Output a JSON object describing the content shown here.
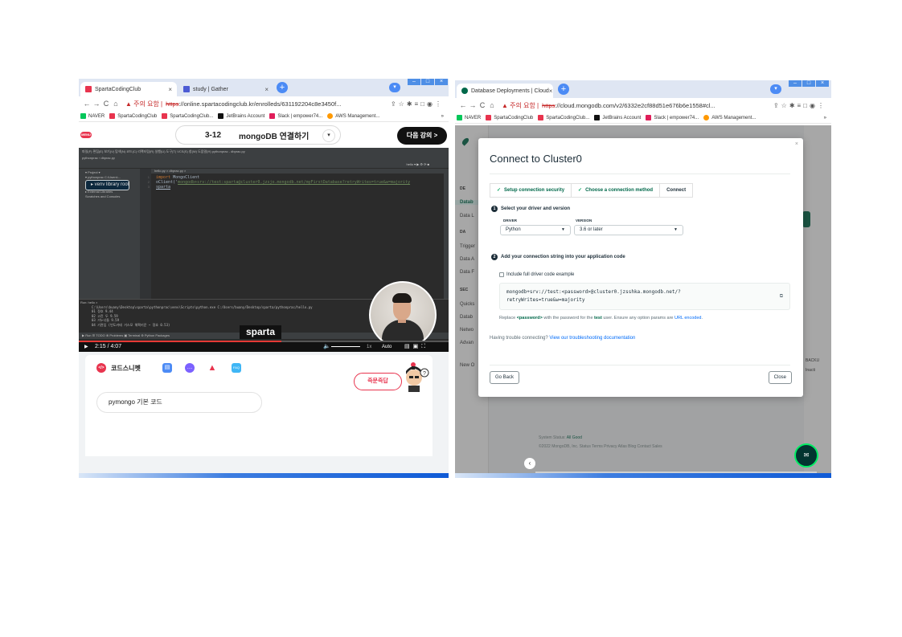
{
  "left": {
    "tabs": [
      {
        "label": "SpartaCodingClub",
        "favcolor": "#e8344e"
      },
      {
        "label": "study | Gather",
        "favcolor": "#4c5bd4"
      }
    ],
    "address": {
      "warning": "▲ 주의 요함 |",
      "https": "https",
      "url_rest": "://online.spartacodingclub.kr/enrolleds/631192204c8e3450f..."
    },
    "bookmarks": [
      "NAVER",
      "SpartaCodingClub",
      "SpartaCodingClub...",
      "JetBrains Account",
      "Slack | empower74...",
      "AWS Management..."
    ],
    "bookmarks_more": "»",
    "lecture": {
      "number": "3-12",
      "title": "mongoDB 연결하기",
      "next_label": "다음 강의 >"
    },
    "ide": {
      "menu": "파일(F)  편집(E)  보기(V)  탐색(N)  코드(C)  리팩터링(R)  실행(U)  도구(T)  VCS(S)  창(W)  도움말(H)   pythonprac - dbprac.py",
      "crumb": "pythonprac  ›  dbprac.py",
      "run_config": "hello ▾  ▶  ⚙  ⟳  ■",
      "tree": [
        "▾ Project ▾",
        "▾ pythonprac  C:\\Users\\...",
        "  ▸ venv  library root",
        "    dbprac.py",
        "    hello.py",
        "▸ External Libraries",
        "  Scratches and Consoles"
      ],
      "editor_tab": "hello.py  ×   dbprac.py  ×",
      "code_lines": [
        {
          "kw": "import ",
          "rest": "MongoClient"
        },
        {
          "kw": "",
          "rest": "oClient('",
          "str": "mongodb+srv://test:sparta@cluster0.jzsjo.mongodb.net/myFirstDatabase?retryWrites=true&w=majority"
        },
        {
          "kw": "",
          "rest": "sparta"
        }
      ],
      "console_header": "Run:  hello ×",
      "console_lines": [
        "C:\\Users\\buany\\Desktop\\sparta\\pythonprac\\venv\\Scripts\\python.exe C:/Users/buany/Desktop/sparta/pythonprac/hello.py",
        "01 정호 9.44",
        "02 고진 두 9.59",
        "03 거누너들 9.59",
        "04 기관입 (빈도카테 거스모 해확키운 ~ 정호 0.53)"
      ],
      "status": "▶ Run   ☰ TODO   ⊗ Problems   ▣ Terminal   ⊕ Python Packages"
    },
    "caption": "sparta",
    "video": {
      "time": "2:15 / 4:07",
      "progress": 0.547,
      "speed": "1x",
      "quality": "Auto"
    },
    "panel": {
      "snippet_tab": "코드스니펫",
      "ask_label": "즉문즉답",
      "snippet_item": "pymongo 기본 코드"
    }
  },
  "right": {
    "tabs": [
      {
        "label": "Database Deployments | Cloud",
        "favcolor": "#00684a"
      }
    ],
    "address": {
      "warning": "▲ 주의 요함 |",
      "https": "https",
      "url_rest": "://cloud.mongodb.com/v2/6332e2cf88d51e676b6e1558#cl..."
    },
    "bookmarks": [
      "NAVER",
      "SpartaCodingClub",
      "SpartaCodingClub...",
      "JetBrains Account",
      "Slack | empower74...",
      "AWS Management..."
    ],
    "bookmarks_more": "»",
    "sidebar": {
      "groups": [
        "DE",
        "DA",
        "SEC"
      ],
      "items": [
        "Datab",
        "Data L",
        "Trigger",
        "Data A",
        "Data F",
        "Quicks",
        "Datab",
        "Netwo",
        "Advan",
        "New O"
      ]
    },
    "right_col": [
      "BACKU",
      "Inacti"
    ],
    "footer": {
      "status_label": "System Status:",
      "status_value": "All Good",
      "links": "©2022 MongoDB, Inc.   Status   Terms   Privacy   Atlas Blog   Contact Sales"
    },
    "modal": {
      "close": "×",
      "title": "Connect to Cluster0",
      "steps": [
        "Setup connection security",
        "Choose a connection method",
        "Connect"
      ],
      "step1_title": "Select your driver and version",
      "driver_label": "DRIVER",
      "driver_value": "Python",
      "version_label": "VERSION",
      "version_value": "3.6 or later",
      "step2_title": "Add your connection string into your application code",
      "include_label": "Include full driver code example",
      "conn_line1": "mongodb+srv://test:<password>@cluster0.jzsshka.mongodb.net/?",
      "conn_line2": "retryWrites=true&w=majority",
      "replace_pre": "Replace ",
      "replace_pw": "<password>",
      "replace_mid": " with the password for the ",
      "replace_user": "test",
      "replace_post": " user. Ensure any option params are ",
      "replace_link": "URL encoded",
      "replace_end": ".",
      "trouble_pre": "Having trouble connecting? ",
      "trouble_link": "View our troubleshooting documentation",
      "back_label": "Go Back",
      "close_label": "Close"
    }
  },
  "icons": {
    "back": "←",
    "forward": "→",
    "reload": "C",
    "home": "⌂",
    "dropdown": "▾",
    "checkmark": "✓",
    "copy": "⧉"
  }
}
